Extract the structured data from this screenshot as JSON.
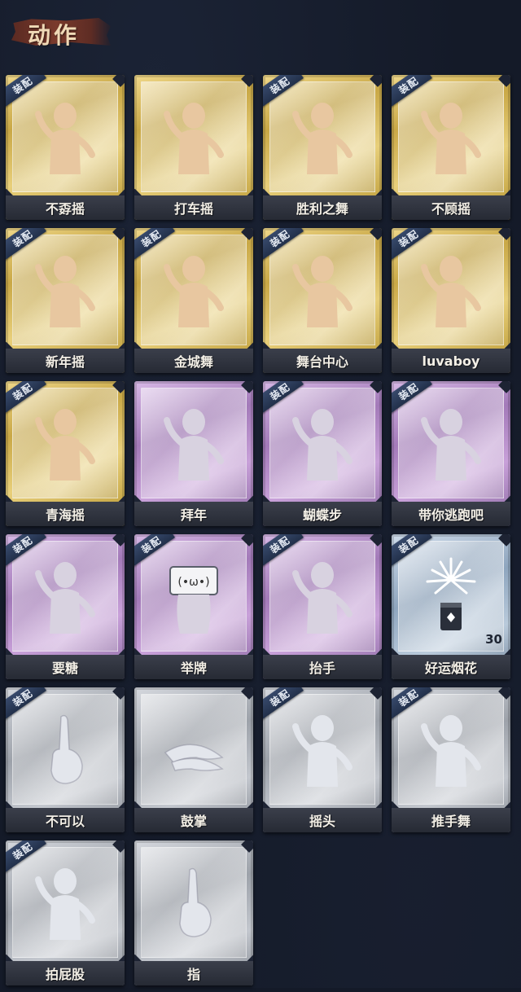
{
  "header": {
    "title": "动作"
  },
  "equipped_label": "装配",
  "cards": [
    {
      "name": "不孬摇",
      "tier": "gold",
      "equipped": true,
      "icon": "dance-pose-icon"
    },
    {
      "name": "打车摇",
      "tier": "gold",
      "equipped": false,
      "icon": "dance-pose-icon"
    },
    {
      "name": "胜利之舞",
      "tier": "gold",
      "equipped": true,
      "icon": "dance-pose-icon"
    },
    {
      "name": "不顾摇",
      "tier": "gold",
      "equipped": true,
      "icon": "dance-pose-icon"
    },
    {
      "name": "新年摇",
      "tier": "gold",
      "equipped": true,
      "icon": "dance-pose-icon"
    },
    {
      "name": "金城舞",
      "tier": "gold",
      "equipped": true,
      "icon": "dance-pose-icon"
    },
    {
      "name": "舞台中心",
      "tier": "gold",
      "equipped": true,
      "icon": "dance-pose-icon"
    },
    {
      "name": "luvaboy",
      "tier": "gold",
      "equipped": true,
      "icon": "dance-pose-icon"
    },
    {
      "name": "青海摇",
      "tier": "gold",
      "equipped": true,
      "icon": "dance-pose-icon"
    },
    {
      "name": "拜年",
      "tier": "purple",
      "equipped": false,
      "icon": "bow-pose-icon"
    },
    {
      "name": "蝴蝶步",
      "tier": "purple",
      "equipped": true,
      "icon": "dance-pose-icon"
    },
    {
      "name": "带你逃跑吧",
      "tier": "purple",
      "equipped": true,
      "icon": "dance-pose-icon"
    },
    {
      "name": "要糖",
      "tier": "purple",
      "equipped": true,
      "icon": "reach-pose-icon"
    },
    {
      "name": "举牌",
      "tier": "purple",
      "equipped": true,
      "icon": "sign-pose-icon"
    },
    {
      "name": "抬手",
      "tier": "purple",
      "equipped": true,
      "icon": "raise-hand-pose-icon"
    },
    {
      "name": "好运烟花",
      "tier": "blue",
      "equipped": true,
      "icon": "firework-icon",
      "count": "30"
    },
    {
      "name": "不可以",
      "tier": "grey",
      "equipped": true,
      "icon": "finger-wag-icon"
    },
    {
      "name": "鼓掌",
      "tier": "grey",
      "equipped": false,
      "icon": "clap-icon"
    },
    {
      "name": "摇头",
      "tier": "grey",
      "equipped": true,
      "icon": "shake-head-pose-icon"
    },
    {
      "name": "推手舞",
      "tier": "grey",
      "equipped": true,
      "icon": "push-dance-pose-icon"
    },
    {
      "name": "拍屁股",
      "tier": "grey",
      "equipped": true,
      "icon": "slap-pose-icon"
    },
    {
      "name": "指",
      "tier": "grey",
      "equipped": false,
      "icon": "point-icon"
    }
  ]
}
